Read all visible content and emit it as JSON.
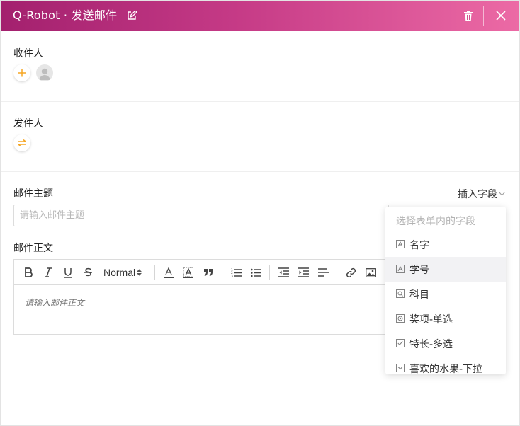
{
  "titlebar": {
    "title": "Q-Robot · 发送邮件"
  },
  "recipients": {
    "label": "收件人"
  },
  "sender": {
    "label": "发件人"
  },
  "subject": {
    "label": "邮件主题",
    "placeholder": "请输入邮件主题",
    "insert_field_label": "插入字段"
  },
  "body": {
    "label": "邮件正文",
    "placeholder": "请输入邮件正文",
    "toolbar": {
      "font_size": "Normal"
    }
  },
  "field_dropdown": {
    "header": "选择表单内的字段",
    "items": [
      {
        "label": "名字",
        "icon": "text-field-icon"
      },
      {
        "label": "学号",
        "icon": "text-field-icon",
        "active": true
      },
      {
        "label": "科目",
        "icon": "search-field-icon"
      },
      {
        "label": "奖项-单选",
        "icon": "radio-field-icon"
      },
      {
        "label": "特长-多选",
        "icon": "checkbox-field-icon"
      },
      {
        "label": "喜欢的水果-下拉",
        "icon": "dropdown-field-icon"
      }
    ]
  },
  "colors": {
    "accent": "#c53a86",
    "orange": "#f5a623"
  }
}
